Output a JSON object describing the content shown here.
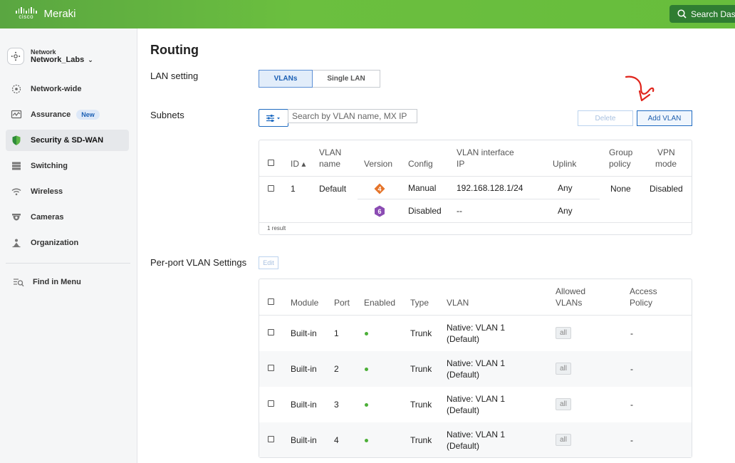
{
  "header": {
    "brand_small": "cisco",
    "brand": "Meraki",
    "search_label": "Search Dash"
  },
  "sidebar": {
    "network_caption": "Network",
    "network_name": "Network_Labs",
    "items": [
      {
        "label": "Network-wide",
        "icon": "network-wide-icon"
      },
      {
        "label": "Assurance",
        "icon": "assurance-icon",
        "badge": "New"
      },
      {
        "label": "Security & SD-WAN",
        "icon": "shield-icon",
        "active": true
      },
      {
        "label": "Switching",
        "icon": "switch-icon"
      },
      {
        "label": "Wireless",
        "icon": "wifi-icon"
      },
      {
        "label": "Cameras",
        "icon": "camera-icon"
      },
      {
        "label": "Organization",
        "icon": "organization-icon"
      }
    ],
    "find": "Find in Menu"
  },
  "page": {
    "title": "Routing",
    "lan_setting_label": "LAN setting",
    "lan_options": [
      "VLANs",
      "Single LAN"
    ],
    "subnets_label": "Subnets",
    "search_placeholder": "Search by VLAN name, MX IP",
    "delete_label": "Delete",
    "add_vlan_label": "Add VLAN",
    "per_port_label": "Per-port VLAN Settings",
    "edit_label": "Edit"
  },
  "subnets_table": {
    "headers": {
      "id": "ID ▴",
      "vlan_name_1": "VLAN",
      "vlan_name_2": "name",
      "version": "Version",
      "config": "Config",
      "vlan_ip_1": "VLAN interface",
      "vlan_ip_2": "IP",
      "uplink": "Uplink",
      "group_1": "Group",
      "group_2": "policy",
      "vpn_1": "VPN",
      "vpn_2": "mode"
    },
    "row": {
      "id": "1",
      "name": "Default",
      "v4_badge": "4",
      "v4_config": "Manual",
      "v4_ip": "192.168.128.1/24",
      "v4_uplink": "Any",
      "v6_badge": "6",
      "v6_config": "Disabled",
      "v6_ip": "--",
      "v6_uplink": "Any",
      "group_policy": "None",
      "vpn_mode": "Disabled"
    },
    "result_count": "1 result"
  },
  "ports_table": {
    "headers": {
      "module": "Module",
      "port": "Port",
      "enabled": "Enabled",
      "type": "Type",
      "vlan": "VLAN",
      "allowed_1": "Allowed",
      "allowed_2": "VLANs",
      "access_1": "Access",
      "access_2": "Policy"
    },
    "rows": [
      {
        "module": "Built-in",
        "port": "1",
        "type": "Trunk",
        "vlan_1": "Native: VLAN 1",
        "vlan_2": "(Default)",
        "allowed": "all",
        "policy": "-"
      },
      {
        "module": "Built-in",
        "port": "2",
        "type": "Trunk",
        "vlan_1": "Native: VLAN 1",
        "vlan_2": "(Default)",
        "allowed": "all",
        "policy": "-"
      },
      {
        "module": "Built-in",
        "port": "3",
        "type": "Trunk",
        "vlan_1": "Native: VLAN 1",
        "vlan_2": "(Default)",
        "allowed": "all",
        "policy": "-"
      },
      {
        "module": "Built-in",
        "port": "4",
        "type": "Trunk",
        "vlan_1": "Native: VLAN 1",
        "vlan_2": "(Default)",
        "allowed": "all",
        "policy": "-"
      }
    ]
  },
  "colors": {
    "accent": "#1f6bc1",
    "brand_green": "#67bd3c",
    "enabled_dot": "#4caf38",
    "ipv4_badge": "#e5742a",
    "ipv6_badge": "#8b4cb3",
    "annotation_arrow": "#e0241b"
  }
}
